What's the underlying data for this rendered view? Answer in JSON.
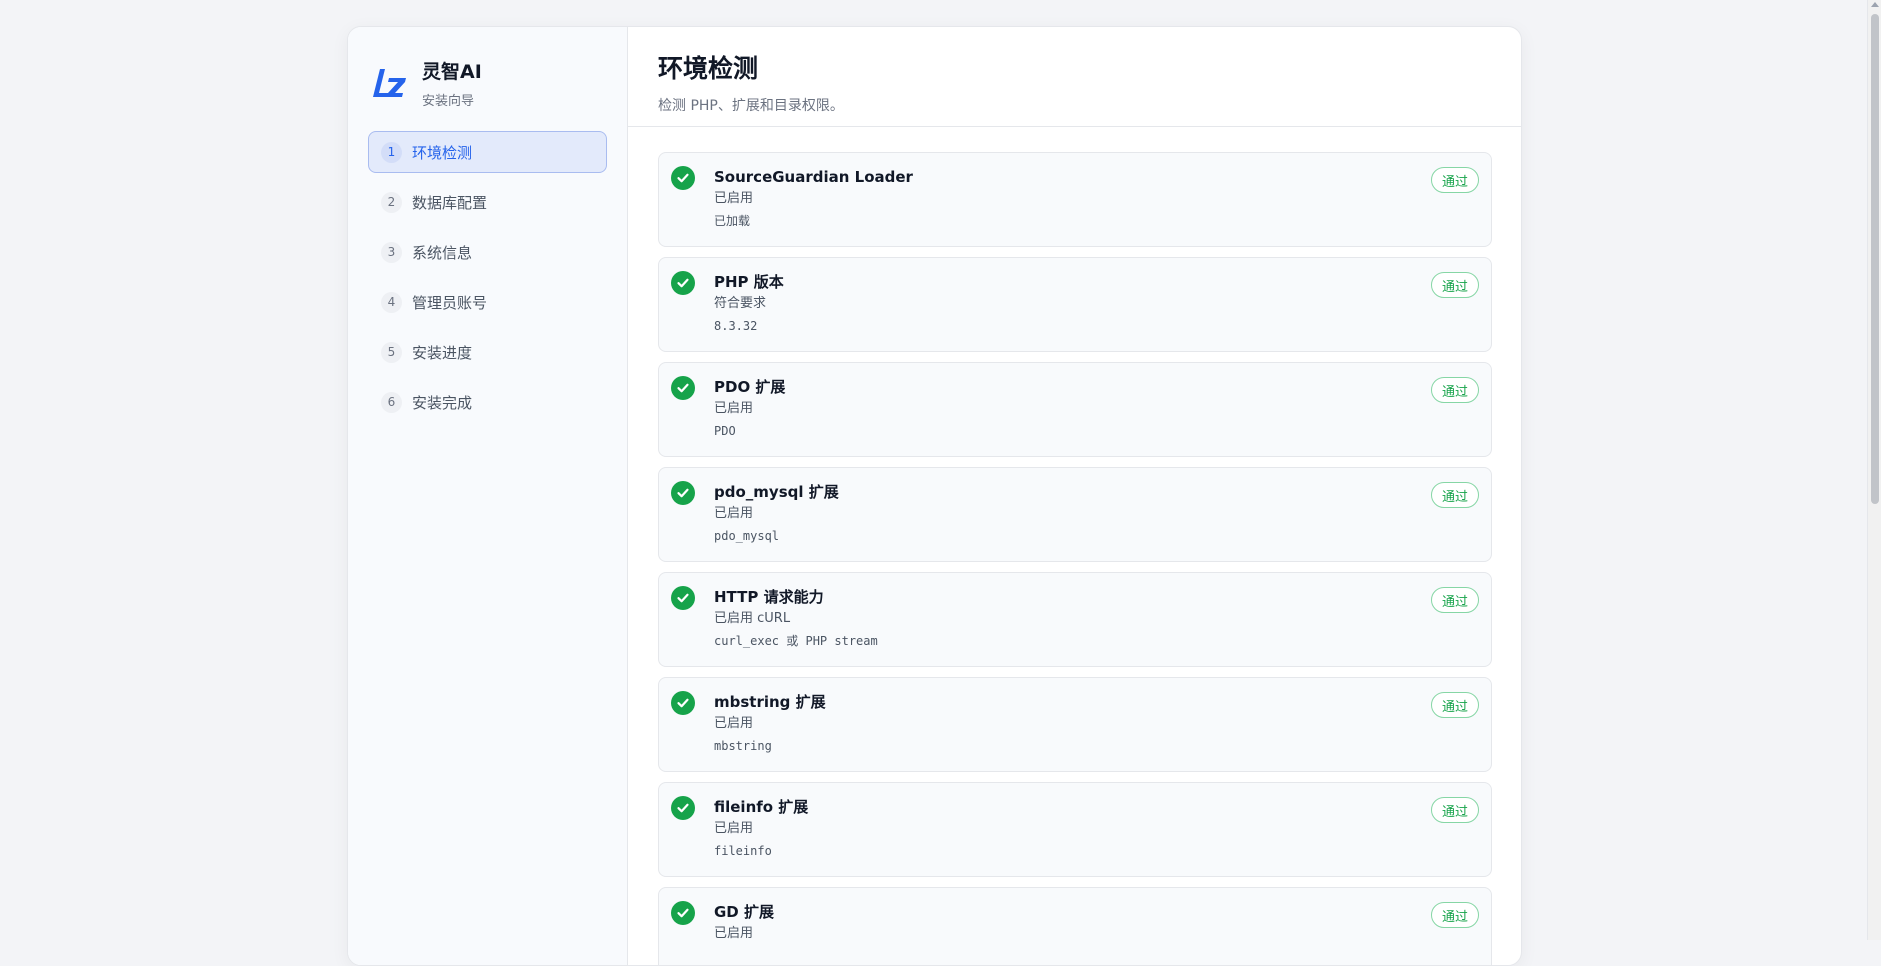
{
  "brand": {
    "name": "灵智AI",
    "subtitle": "安装向导"
  },
  "steps": [
    {
      "num": "1",
      "label": "环境检测"
    },
    {
      "num": "2",
      "label": "数据库配置"
    },
    {
      "num": "3",
      "label": "系统信息"
    },
    {
      "num": "4",
      "label": "管理员账号"
    },
    {
      "num": "5",
      "label": "安装进度"
    },
    {
      "num": "6",
      "label": "安装完成"
    }
  ],
  "active_step": "1",
  "header": {
    "title": "环境检测",
    "subtitle": "检测 PHP、扩展和目录权限。"
  },
  "checks": [
    {
      "name": "SourceGuardian Loader",
      "status": "已启用",
      "detail": "已加载",
      "badge": "通过"
    },
    {
      "name": "PHP 版本",
      "status": "符合要求",
      "detail": "8.3.32",
      "badge": "通过"
    },
    {
      "name": "PDO 扩展",
      "status": "已启用",
      "detail": "PDO",
      "badge": "通过"
    },
    {
      "name": "pdo_mysql 扩展",
      "status": "已启用",
      "detail": "pdo_mysql",
      "badge": "通过"
    },
    {
      "name": "HTTP 请求能力",
      "status": "已启用 cURL",
      "detail": "curl_exec 或 PHP stream",
      "badge": "通过"
    },
    {
      "name": "mbstring 扩展",
      "status": "已启用",
      "detail": "mbstring",
      "badge": "通过"
    },
    {
      "name": "fileinfo 扩展",
      "status": "已启用",
      "detail": "fileinfo",
      "badge": "通过"
    },
    {
      "name": "GD 扩展",
      "status": "已启用",
      "detail": "",
      "badge": "通过"
    }
  ],
  "colors": {
    "accent": "#2563eb",
    "success": "#16a34a",
    "background": "#f3f4f7"
  },
  "icons": {
    "logo": "lz-logo",
    "check": "check-circle-icon"
  }
}
